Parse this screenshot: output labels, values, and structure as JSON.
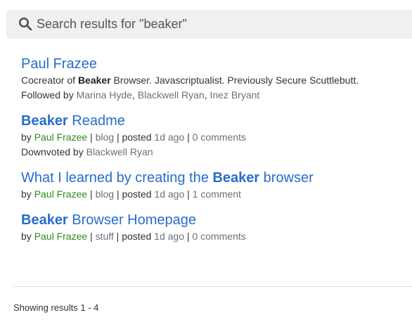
{
  "search": {
    "value": "Search results for \"beaker\""
  },
  "results": [
    {
      "title_parts": [
        "Paul Frazee"
      ],
      "description": {
        "pre": "Cocreator of ",
        "bold": "Beaker",
        "post": " Browser. Javascriptualist. Previously Secure Scuttlebutt."
      },
      "followed_by_label": "Followed by",
      "followers": [
        "Marina Hyde",
        "Blackwell Ryan",
        "Inez Bryant"
      ],
      "comma": ", "
    },
    {
      "title_bold": "Beaker",
      "title_rest": " Readme",
      "by_label": "by",
      "author": "Paul Frazee",
      "pipe": " | ",
      "category": "blog",
      "posted_label": "posted",
      "posted": "1d ago",
      "comments": "0 comments",
      "downvoted_label": "Downvoted by",
      "downvoted_by": "Blackwell Ryan"
    },
    {
      "title_pre": "What I learned by creating the ",
      "title_bold": "Beaker",
      "title_post": " browser",
      "by_label": "by",
      "author": "Paul Frazee",
      "category": "blog",
      "posted_label": "posted",
      "posted": "1d ago",
      "comments": "1 comment"
    },
    {
      "title_bold": "Beaker",
      "title_rest": " Browser Homepage",
      "by_label": "by",
      "author": "Paul Frazee",
      "category": "stuff",
      "posted_label": "posted",
      "posted": "1d ago",
      "comments": "0 comments"
    }
  ],
  "footer": {
    "summary": "Showing results 1 - 4"
  },
  "colors": {
    "link": "#2a6cc9",
    "author": "#2c8a1a",
    "muted": "#6b7078",
    "search_bg": "#eff0f2"
  },
  "icons": {
    "search": "search-icon"
  }
}
